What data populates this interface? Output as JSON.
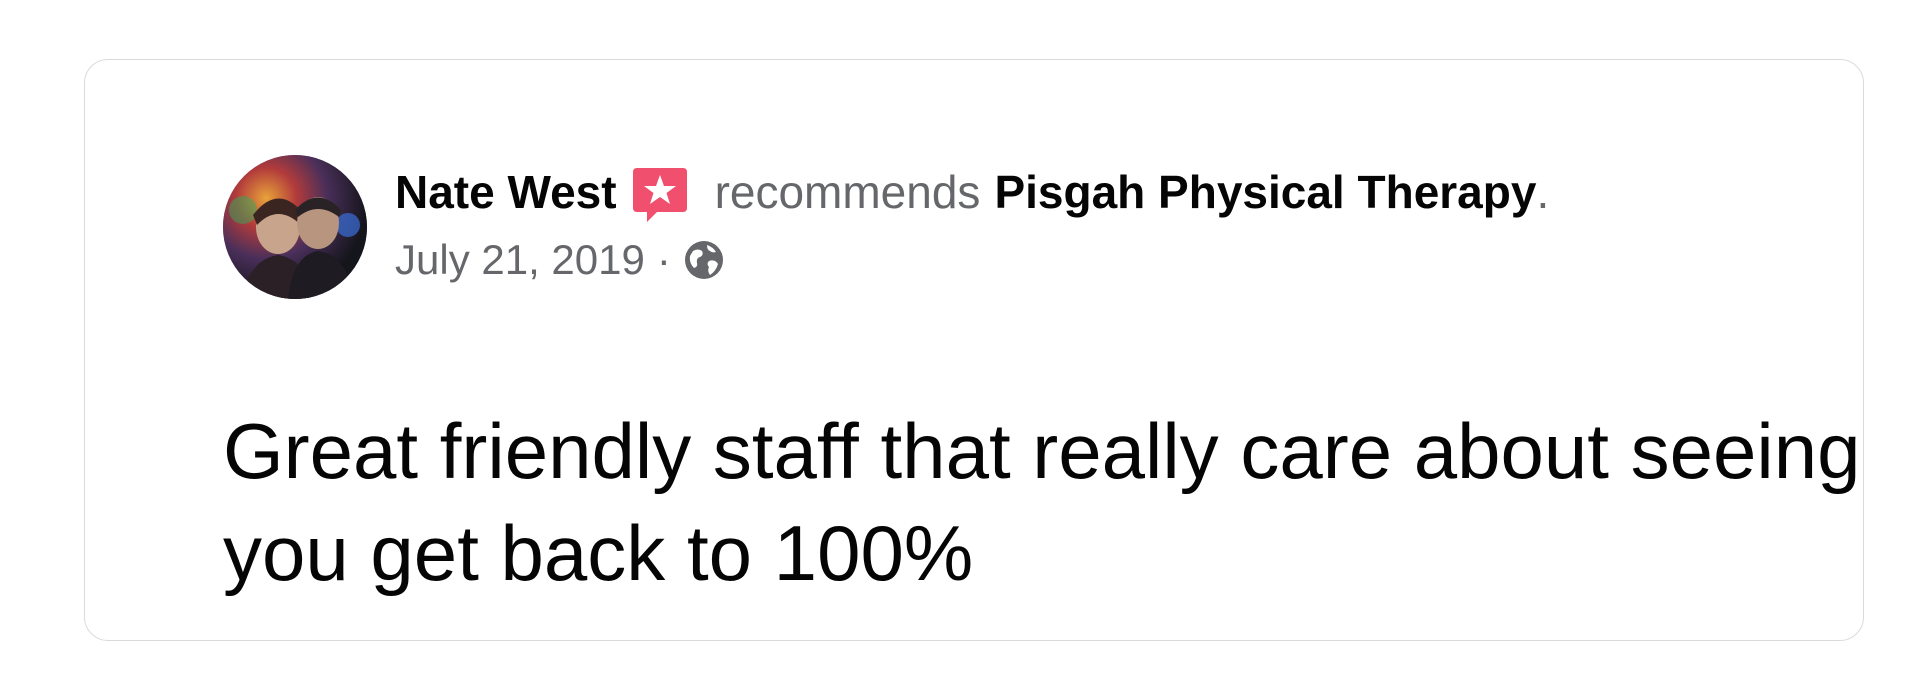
{
  "post": {
    "author": "Nate West",
    "verb": "recommends",
    "page_name": "Pisgah Physical Therapy",
    "period": ".",
    "date": "July 21, 2019",
    "separator": "·",
    "privacy_icon": "globe-icon",
    "recommendation_icon": "star-speech-bubble-icon",
    "body": "Great friendly staff that really care about seeing you get back to 100%"
  },
  "colors": {
    "primary_text": "#050505",
    "secondary_text": "#65676b",
    "badge": "#f0506e",
    "card_border": "#d9dadc"
  }
}
